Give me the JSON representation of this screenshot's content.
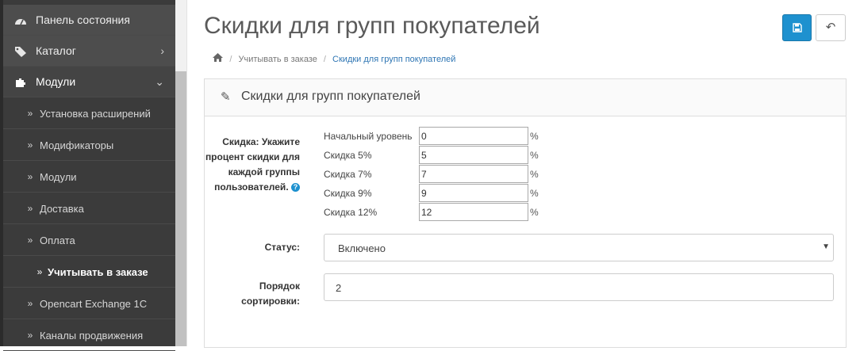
{
  "sidebar": {
    "top_items": [
      {
        "label": "Панель состояния",
        "icon": "dashboard-icon"
      },
      {
        "label": "Каталог",
        "icon": "tag-icon"
      },
      {
        "label": "Модули",
        "icon": "puzzle-icon"
      }
    ],
    "sub_items": [
      {
        "label": "Установка расширений"
      },
      {
        "label": "Модификаторы"
      },
      {
        "label": "Модули"
      },
      {
        "label": "Доставка"
      },
      {
        "label": "Оплата"
      },
      {
        "label": "Учитывать в заказе"
      },
      {
        "label": "Opencart Exchange 1C"
      },
      {
        "label": "Каналы продвижения"
      }
    ]
  },
  "header": {
    "title": "Скидки для групп покупателей",
    "breadcrumb": [
      {
        "label": "Учитывать в заказе"
      },
      {
        "label": "Скидки для групп покупателей"
      }
    ]
  },
  "panel": {
    "title": "Скидки для групп покупателей",
    "discount_label": "Скидка: Укажите процент скидки для каждой группы пользователей.",
    "discount_rows": [
      {
        "label": "Начальный уровень",
        "value": "0",
        "unit": "%"
      },
      {
        "label": "Скидка 5%",
        "value": "5",
        "unit": "%"
      },
      {
        "label": "Скидка 7%",
        "value": "7",
        "unit": "%"
      },
      {
        "label": "Скидка 9%",
        "value": "9",
        "unit": "%"
      },
      {
        "label": "Скидка 12%",
        "value": "12",
        "unit": "%"
      }
    ],
    "status_label": "Статус:",
    "status_value": "Включено",
    "sort_label": "Порядок сортировки:",
    "sort_value": "2"
  },
  "colors": {
    "accent": "#1e91cf",
    "sidebar_bg": "#3b3b3b"
  }
}
